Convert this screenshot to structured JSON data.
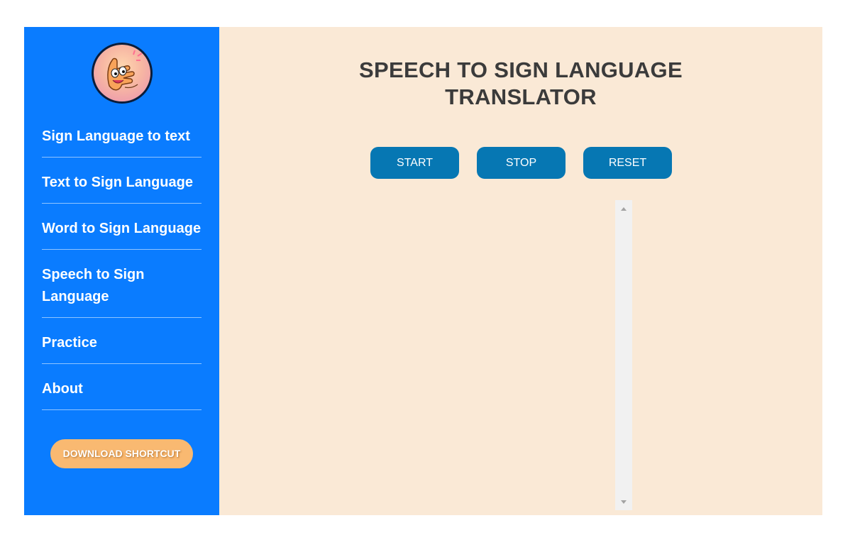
{
  "sidebar": {
    "logo": {
      "icon": "hand-sign-mascot-icon"
    },
    "nav_items": [
      {
        "label": "Sign Language to text"
      },
      {
        "label": "Text to Sign Language"
      },
      {
        "label": "Word to Sign Language"
      },
      {
        "label": "Speech to Sign Language"
      },
      {
        "label": "Practice"
      },
      {
        "label": "About"
      }
    ],
    "download_label": "DOWNLOAD SHORTCUT"
  },
  "main": {
    "title_line1": "SPEECH TO SIGN LANGUAGE",
    "title_line2": "TRANSLATOR",
    "buttons": {
      "start": "START",
      "stop": "STOP",
      "reset": "RESET"
    }
  },
  "colors": {
    "sidebar_bg": "#0a7cff",
    "main_bg": "#fae9d6",
    "button_bg": "#0677b3",
    "download_bg": "#f9b971",
    "title_text": "#3b3b3b"
  }
}
